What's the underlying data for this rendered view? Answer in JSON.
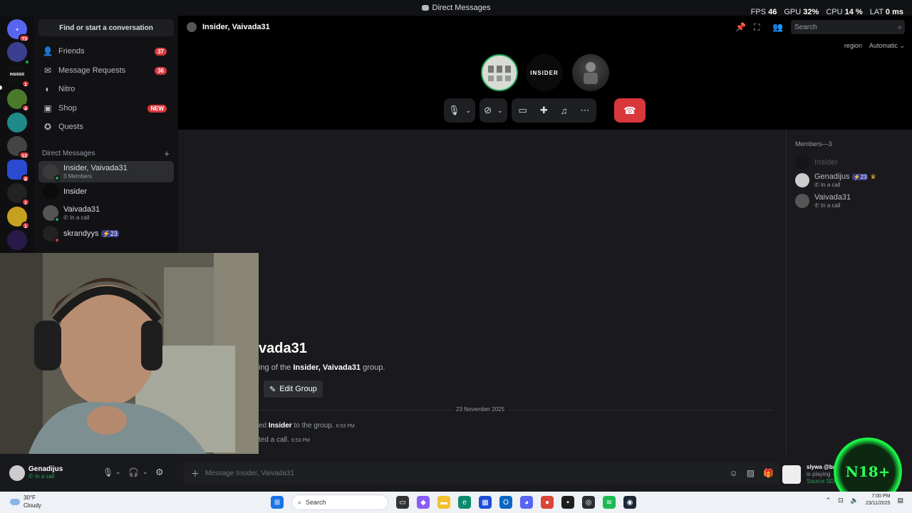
{
  "titlebar": {
    "title": "Direct Messages"
  },
  "stats": {
    "fps_label": "FPS",
    "fps": "46",
    "gpu_label": "GPU",
    "gpu": "32%",
    "cpu_label": "CPU",
    "cpu": "14 %",
    "lat_label": "LAT",
    "lat": "0 ms"
  },
  "guilds": [
    {
      "name": "discord-home",
      "badge": "73",
      "color": "#5865f2"
    },
    {
      "name": "server-1",
      "badge": "",
      "color": "#3a3f8f"
    },
    {
      "name": "server-insider",
      "label": "INSIDER",
      "badge": "1",
      "color": "#111"
    },
    {
      "name": "server-3",
      "badge": "4",
      "color": "#4a7a2a"
    },
    {
      "name": "server-4",
      "badge": "",
      "color": "#1f8a8a"
    },
    {
      "name": "server-5",
      "badge": "12",
      "color": "#444"
    },
    {
      "name": "server-6",
      "badge": "8",
      "color": "#2a4ad0"
    },
    {
      "name": "server-7",
      "badge": "1",
      "color": "#222"
    },
    {
      "name": "server-8",
      "badge": "1",
      "color": "#c8a020"
    },
    {
      "name": "server-9",
      "badge": "",
      "color": "#2a1a4a"
    }
  ],
  "sidebar": {
    "find_label": "Find or start a conversation",
    "nav": [
      {
        "label": "Friends",
        "badge": "37",
        "icon": "friends-icon"
      },
      {
        "label": "Message Requests",
        "badge": "36",
        "icon": "mail-icon"
      },
      {
        "label": "Nitro",
        "badge": "",
        "icon": "nitro-icon"
      },
      {
        "label": "Shop",
        "badge": "NEW",
        "icon": "shop-icon"
      },
      {
        "label": "Quests",
        "badge": "",
        "icon": "quests-icon"
      }
    ],
    "dm_header": "Direct Messages",
    "dms": [
      {
        "name": "Insider, Vaivada31",
        "sub": "3 Members"
      },
      {
        "name": "Insider",
        "sub": ""
      },
      {
        "name": "Vaivada31",
        "sub": "In a call"
      },
      {
        "name": "skrandyys",
        "sub": "",
        "boost": "23"
      }
    ]
  },
  "user": {
    "name": "Genadijus",
    "status": "In a call"
  },
  "channel": {
    "title": "Insider, Vaivada31",
    "search_placeholder": "Search",
    "region_label": "region",
    "region_value": "Automatic"
  },
  "call": {
    "tiles": [
      {
        "label": ""
      },
      {
        "label": "INSIDER"
      },
      {
        "label": ""
      }
    ]
  },
  "chat": {
    "welcome_title": "vada31",
    "welcome_sub_pre": "ing of the ",
    "welcome_sub_group": "Insider, Vaivada31",
    "welcome_sub_post": " group.",
    "edit_group": "Edit Group",
    "date": "23 November 2025",
    "messages": [
      {
        "pre": "ed ",
        "bold": "Insider",
        "post": " to the group.",
        "time": "6:53 PM"
      },
      {
        "pre": "ted a call.",
        "bold": "",
        "post": "",
        "time": "6:53 PM"
      }
    ],
    "composer_placeholder": "Message Insider, Vaivada31"
  },
  "members": {
    "header": "Members—3",
    "list": [
      {
        "name": "Insider",
        "sub": ""
      },
      {
        "name": "Genadijus",
        "sub": "In a call",
        "boost": "23"
      },
      {
        "name": "Vaivada31",
        "sub": "In a call"
      }
    ]
  },
  "activity": {
    "name": "slywa @bandit",
    "line2": "is playing",
    "line3": "Source SDK Base 2007"
  },
  "overlay": {
    "text": "N18+"
  },
  "taskbar": {
    "weather_temp": "30°F",
    "weather_desc": "Cloudy",
    "search_label": "Search",
    "time": "7:00 PM",
    "date": "23/11/2025"
  }
}
